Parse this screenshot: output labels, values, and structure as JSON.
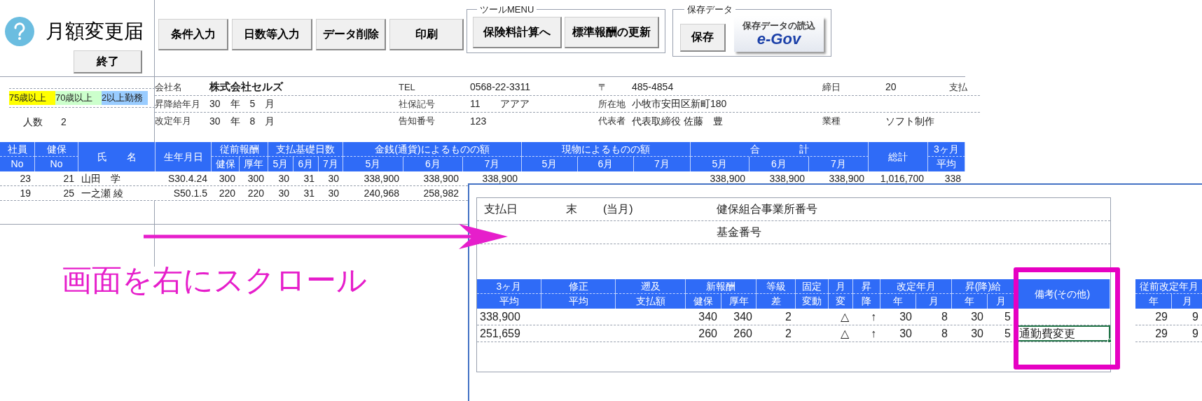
{
  "app_title": "月額変更届",
  "exit_button": "終了",
  "toolbar_buttons": [
    "条件入力",
    "日数等入力",
    "データ削除",
    "印刷"
  ],
  "tool_menu": {
    "title": "ツールMENU",
    "buttons": [
      "保険料計算へ",
      "標準報酬の更新"
    ]
  },
  "saved_data": {
    "title": "保存データ",
    "save_button": "保存",
    "egov_caption": "保存データの読込",
    "egov_logo": "e-Gov"
  },
  "legend": [
    {
      "label": "75歳以上",
      "color": "#ffff00"
    },
    {
      "label": "70歳以上",
      "color": "#ccffcc"
    },
    {
      "label": "2以上勤務",
      "color": "#99ccff"
    }
  ],
  "headcount": {
    "label": "人数",
    "value": "2"
  },
  "company_info": [
    [
      {
        "label": "会社名",
        "value": "株式会社セルズ"
      },
      {
        "label": "TEL",
        "value": "0568-22-3311"
      },
      {
        "label": "〒",
        "value": "485-4854"
      },
      {
        "label": "締日",
        "value": "20"
      },
      {
        "label": "支払"
      }
    ],
    [
      {
        "label": "昇降給年月",
        "value": "30　年　5　月"
      },
      {
        "label": "社保記号",
        "value": "11　　アアア"
      },
      {
        "label": "所在地",
        "value": "小牧市安田区新町180"
      }
    ],
    [
      {
        "label": "改定年月",
        "value": "30　年　8　月"
      },
      {
        "label": "告知番号",
        "value": "123"
      },
      {
        "label": "代表者",
        "value": "代表取締役 佐藤　豊"
      },
      {
        "label": "業種",
        "value": "ソフト制作"
      }
    ]
  ],
  "table": {
    "column_groups": [
      {
        "kind": "stacked",
        "label": "社員"
      },
      {
        "kind": "stacked",
        "label": "健保"
      },
      {
        "kind": "single",
        "label": "氏　　名"
      },
      {
        "kind": "single",
        "label": "生年月日"
      },
      {
        "kind": "group",
        "label": "従前報酬"
      },
      {
        "kind": "group",
        "label": "支払基礎日数"
      },
      {
        "kind": "group",
        "label": "金銭(通貨)によるものの額"
      },
      {
        "kind": "group",
        "label": "現物によるものの額"
      },
      {
        "kind": "group",
        "label": "合　　　　計"
      },
      {
        "kind": "single",
        "label": "総計"
      },
      {
        "kind": "stacked",
        "label": "3ヶ月"
      }
    ],
    "columns": [
      "No",
      "No",
      "",
      "",
      "健保",
      "厚年",
      "5月",
      "6月",
      "7月",
      "5月",
      "6月",
      "7月",
      "5月",
      "6月",
      "7月",
      "5月",
      "6月",
      "7月",
      "",
      "平均"
    ],
    "rows": [
      [
        "23",
        "21",
        "山田　学",
        "S30.4.24",
        "300",
        "300",
        "30",
        "31",
        "30",
        "338,900",
        "338,900",
        "338,900",
        "",
        "",
        "",
        "338,900",
        "338,900",
        "338,900",
        "1,016,700",
        "338"
      ],
      [
        "19",
        "25",
        "一之瀬 綾",
        "S50.1.5",
        "220",
        "220",
        "30",
        "31",
        "30",
        "240,968",
        "258,982"
      ]
    ]
  },
  "scrolled_view": {
    "pay_day": {
      "label": "支払日",
      "value": "末",
      "note": "(当月)"
    },
    "info_labels": [
      "健保組合事業所番号",
      "基金番号"
    ],
    "column_groups": [
      {
        "kind": "stacked",
        "label": "3ヶ月"
      },
      {
        "kind": "stacked",
        "label": "修正"
      },
      {
        "kind": "stacked",
        "label": "遡及"
      },
      {
        "kind": "group",
        "label": "新報酬"
      },
      {
        "kind": "stacked",
        "label": "等級"
      },
      {
        "kind": "stacked",
        "label": "固定"
      },
      {
        "kind": "stacked",
        "label": "月"
      },
      {
        "kind": "stacked",
        "label": "昇"
      },
      {
        "kind": "group",
        "label": "改定年月"
      },
      {
        "kind": "group",
        "label": "昇(降)給"
      },
      {
        "kind": "single",
        "label": "備考(その他)"
      }
    ],
    "columns": [
      "平均",
      "平均",
      "支払額",
      "健保",
      "厚年",
      "差",
      "変動",
      "変",
      "降",
      "年",
      "月",
      "年",
      "月",
      ""
    ],
    "rows": [
      {
        "cells": [
          "338,900",
          "",
          "",
          "340",
          "340",
          "2",
          "",
          "△",
          "↑",
          "30",
          "8",
          "30",
          "5",
          ""
        ],
        "selected": false
      },
      {
        "cells": [
          "251,659",
          "",
          "",
          "260",
          "260",
          "2",
          "",
          "△",
          "↑",
          "30",
          "8",
          "30",
          "5",
          "通勤費変更"
        ],
        "selected": true
      }
    ],
    "previous_revision": {
      "column_groups": [
        {
          "kind": "group",
          "label": "従前改定年月"
        }
      ],
      "columns": [
        "年",
        "月"
      ],
      "rows": [
        [
          "29",
          "9"
        ],
        [
          "29",
          "9"
        ]
      ]
    }
  },
  "annotation": {
    "text": "画面を右にスクロール"
  }
}
